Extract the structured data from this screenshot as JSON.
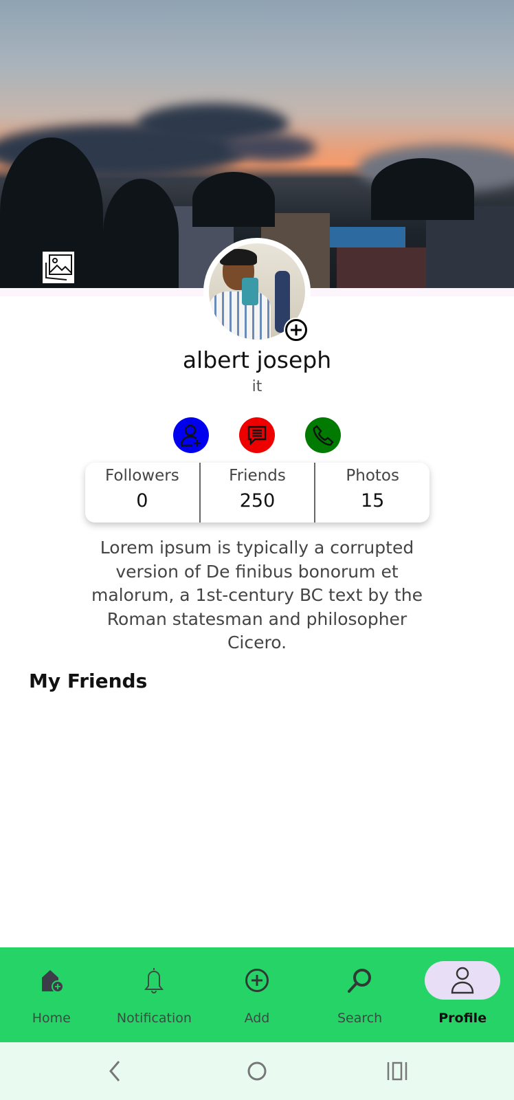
{
  "profile": {
    "name": "albert joseph",
    "role": "it"
  },
  "actions": [
    {
      "icon": "add-friend-icon",
      "color": "#0000ee"
    },
    {
      "icon": "message-icon",
      "color": "#ee0000"
    },
    {
      "icon": "phone-icon",
      "color": "#007a00"
    }
  ],
  "stats": [
    {
      "label": "Followers",
      "value": "0"
    },
    {
      "label": "Friends",
      "value": "250"
    },
    {
      "label": "Photos",
      "value": "15"
    }
  ],
  "bio": "Lorem ipsum is typically a corrupted version of De finibus bonorum et malorum, a 1st-century BC text by the Roman statesman and philosopher Cicero.",
  "friends_section": {
    "title": "My Friends"
  },
  "bottom_nav": {
    "active": "Profile",
    "accent": "#26d366",
    "items": [
      {
        "label": "Home",
        "icon": "home-add-icon"
      },
      {
        "label": "Notification",
        "icon": "bell-icon"
      },
      {
        "label": "Add",
        "icon": "plus-circle-icon"
      },
      {
        "label": "Search",
        "icon": "search-icon"
      },
      {
        "label": "Profile",
        "icon": "person-icon"
      }
    ]
  }
}
